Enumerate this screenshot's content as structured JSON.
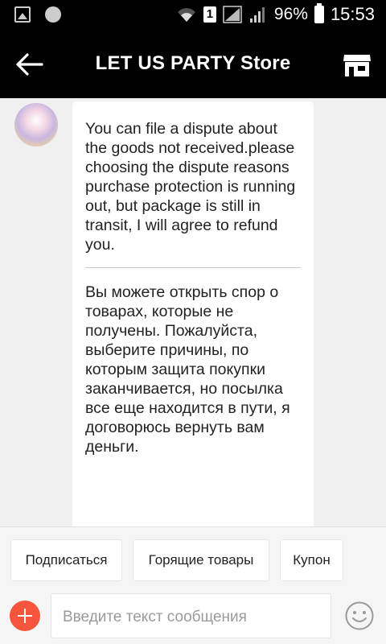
{
  "status_bar": {
    "battery_percent": "96%",
    "time": "15:53",
    "sim_slot": "1",
    "icons": [
      "image-icon",
      "settings-dot-icon",
      "wifi-icon",
      "sim-1-icon",
      "signal-icon",
      "battery-icon"
    ]
  },
  "header": {
    "title": "LET US PARTY Store",
    "back_icon": "arrow-left-icon",
    "store_icon": "store-icon"
  },
  "chat": {
    "message": {
      "text_en": "You can file a dispute about the goods not received.please choosing the dispute reasons purchase protection is running out, but package is still in transit, I will agree to refund you.",
      "text_ru": "Вы можете открыть спор о товарах, которые не получены. Пожалуйста, выберите причины, по которым защита покупки заканчивается, но посылка все еще находится в пути, я договорюсь вернуть вам деньги."
    }
  },
  "quick_replies": [
    "Подписаться",
    "Горящие товары",
    "Купон"
  ],
  "input": {
    "placeholder": "Введите текст сообщения"
  },
  "colors": {
    "header_bg": "#000000",
    "accent_add": "#f4553c",
    "chat_bg": "#f0f0f0"
  }
}
